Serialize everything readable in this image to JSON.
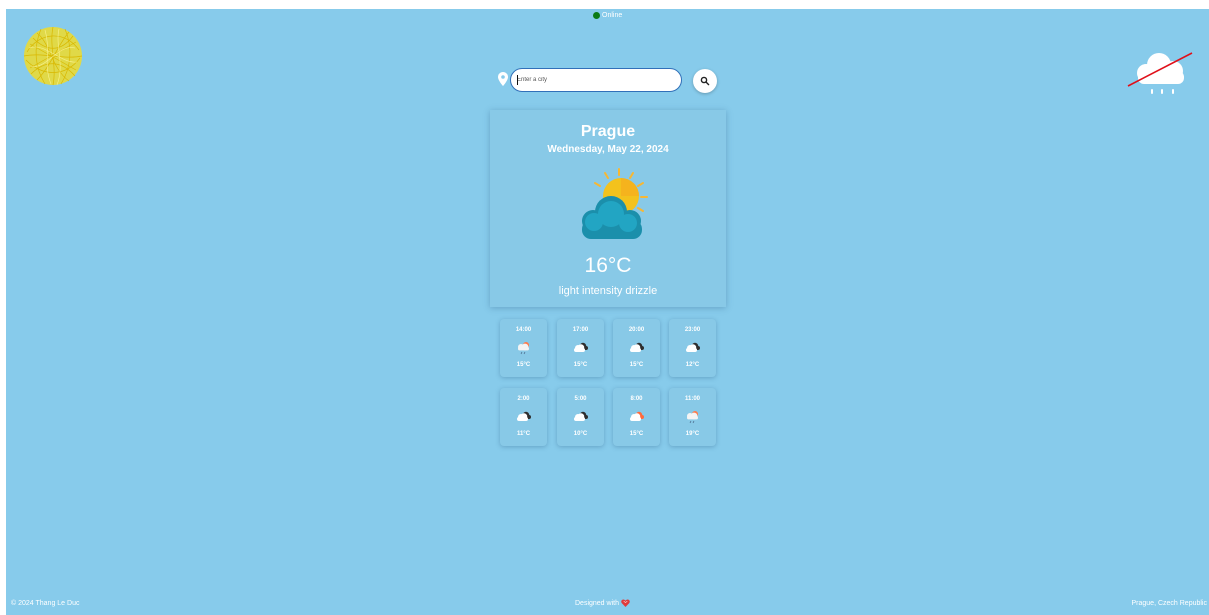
{
  "status": {
    "label": "Online",
    "color": "#0b7a16"
  },
  "search": {
    "placeholder": "Enter a city",
    "value": ""
  },
  "current": {
    "city": "Prague",
    "date": "Wednesday, May 22, 2024",
    "temperature": "16°C",
    "description": "light intensity drizzle",
    "icon": "partly-cloudy-sun-icon"
  },
  "forecast": [
    {
      "time": "14:00",
      "temp": "15°C",
      "icon": "drizzle-icon"
    },
    {
      "time": "17:00",
      "temp": "15°C",
      "icon": "cloudy-icon"
    },
    {
      "time": "20:00",
      "temp": "15°C",
      "icon": "cloudy-icon"
    },
    {
      "time": "23:00",
      "temp": "12°C",
      "icon": "cloudy-icon"
    },
    {
      "time": "2:00",
      "temp": "11°C",
      "icon": "cloudy-icon"
    },
    {
      "time": "5:00",
      "temp": "10°C",
      "icon": "cloudy-icon"
    },
    {
      "time": "8:00",
      "temp": "15°C",
      "icon": "cloudy-icon"
    },
    {
      "time": "11:00",
      "temp": "19°C",
      "icon": "drizzle-icon"
    }
  ],
  "footer": {
    "copyright": "© 2024 Thang Le Duc",
    "designed": "Designed with",
    "location": "Prague, Czech Republic"
  },
  "colors": {
    "background": "#87cbeb",
    "accent": "#3170b9",
    "sun": "#f3c21c",
    "cloud": "#1fa0bd"
  }
}
